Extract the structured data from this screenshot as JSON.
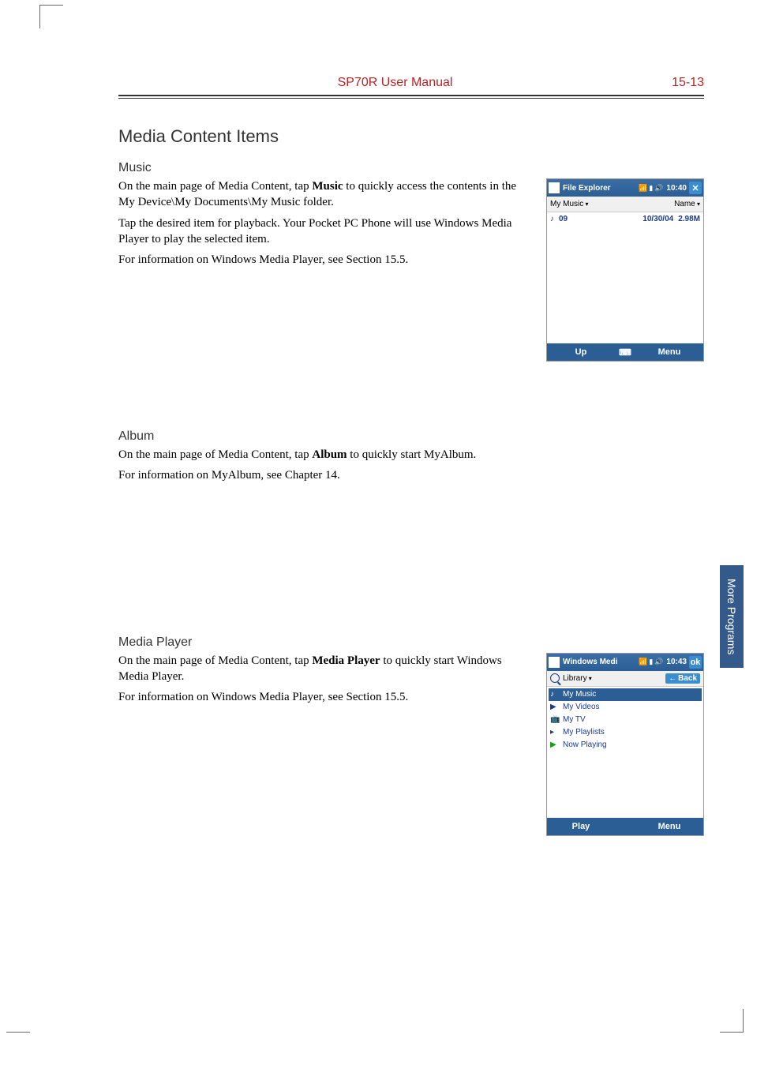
{
  "header": {
    "center": "SP70R User Manual",
    "right": "15-13"
  },
  "section_title": "Media Content Items",
  "side_tab": "More Programs",
  "music": {
    "heading": "Music",
    "p1a": "On the main page of Media Content, tap ",
    "p1b": "Music",
    "p1c": " to quickly access the contents in the My Device\\My Documents\\My Music folder.",
    "p2": "Tap the desired item for playback. Your Pocket PC Phone will use Windows Media Player to play the selected item.",
    "p3": "For information on Windows Media Player, see Section 15.5."
  },
  "album": {
    "heading": "Album",
    "p1a": "On the main page of Media Content, tap ",
    "p1b": "Album",
    "p1c": " to quickly start MyAlbum.",
    "p2": "For information on MyAlbum, see Chapter 14."
  },
  "mediaplayer": {
    "heading": "Media Player",
    "p1a": "On the main page of Media Content, tap ",
    "p1b": "Media Player",
    "p1c": " to quickly start Windows Media Player.",
    "p2": "For information on Windows Media Player, see Section 15.5."
  },
  "screenshot_fe": {
    "title": "File Explorer",
    "time": "10:40",
    "close": "✕",
    "folder": "My Music",
    "sort": "Name",
    "file_name": "09",
    "file_date": "10/30/04",
    "file_size": "2.98M",
    "soft_left": "Up",
    "soft_kbd": "⌨",
    "soft_right": "Menu"
  },
  "screenshot_wmp": {
    "title": "Windows Medi",
    "time": "10:43",
    "ok": "ok",
    "library": "Library",
    "back": "Back",
    "items": {
      "0": "My Music",
      "1": "My Videos",
      "2": "My TV",
      "3": "My Playlists",
      "4": "Now Playing"
    },
    "soft_left": "Play",
    "soft_right": "Menu"
  }
}
